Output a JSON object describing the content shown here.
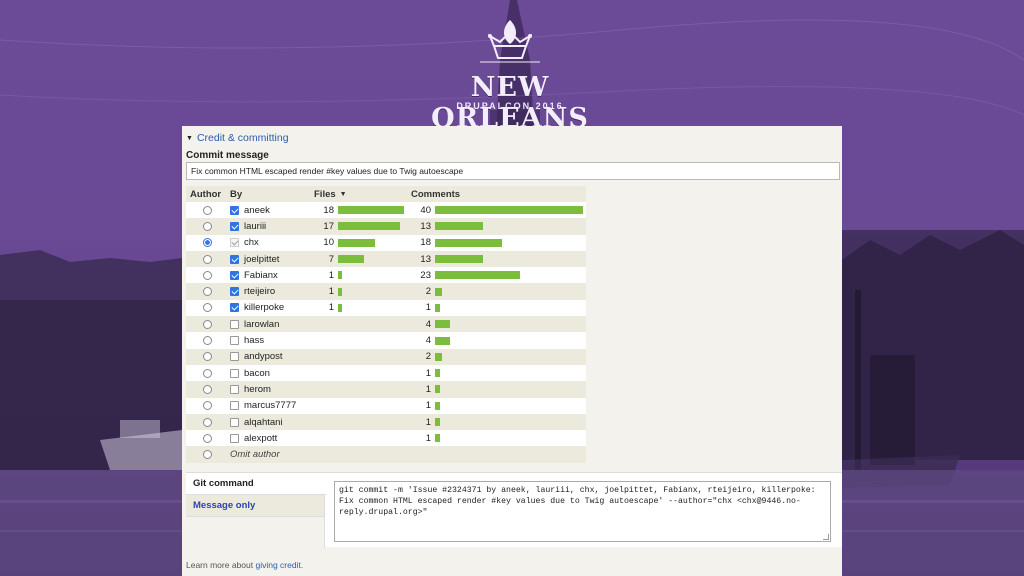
{
  "logo": {
    "title": "NEW ORLEANS",
    "subtitle": "DRUPALCON 2016",
    "icon": "crown-fleur-de-lis-icon"
  },
  "details": {
    "label": "Credit & committing",
    "icon": "triangle-down-icon"
  },
  "commit_message": {
    "label": "Commit message",
    "value": "Fix common HTML escaped render #key values due to Twig autoescape"
  },
  "table": {
    "headers": {
      "author": "Author",
      "by": "By",
      "files": "Files",
      "comments": "Comments"
    },
    "sort_icon": "sort-desc-icon",
    "rows": [
      {
        "name": "aneek",
        "files": "18",
        "comments": "40",
        "files_pct": 1.0,
        "comments_pct": 1.0,
        "author": false,
        "by": "checked"
      },
      {
        "name": "lauriii",
        "files": "17",
        "comments": "13",
        "files_pct": 0.944,
        "comments_pct": 0.325,
        "author": false,
        "by": "checked"
      },
      {
        "name": "chx",
        "files": "10",
        "comments": "18",
        "files_pct": 0.556,
        "comments_pct": 0.45,
        "author": true,
        "by": "disabled"
      },
      {
        "name": "joelpittet",
        "files": "7",
        "comments": "13",
        "files_pct": 0.389,
        "comments_pct": 0.325,
        "author": false,
        "by": "checked"
      },
      {
        "name": "Fabianx",
        "files": "1",
        "comments": "23",
        "files_pct": 0.056,
        "comments_pct": 0.575,
        "author": false,
        "by": "checked"
      },
      {
        "name": "rteijeiro",
        "files": "1",
        "comments": "2",
        "files_pct": 0.056,
        "comments_pct": 0.05,
        "author": false,
        "by": "checked"
      },
      {
        "name": "killerpoke",
        "files": "1",
        "comments": "1",
        "files_pct": 0.056,
        "comments_pct": 0.025,
        "author": false,
        "by": "checked"
      },
      {
        "name": "larowlan",
        "files": "",
        "comments": "4",
        "files_pct": 0,
        "comments_pct": 0.1,
        "author": false,
        "by": "unchecked"
      },
      {
        "name": "hass",
        "files": "",
        "comments": "4",
        "files_pct": 0,
        "comments_pct": 0.1,
        "author": false,
        "by": "unchecked"
      },
      {
        "name": "andypost",
        "files": "",
        "comments": "2",
        "files_pct": 0,
        "comments_pct": 0.05,
        "author": false,
        "by": "unchecked"
      },
      {
        "name": "bacon",
        "files": "",
        "comments": "1",
        "files_pct": 0,
        "comments_pct": 0.025,
        "author": false,
        "by": "unchecked"
      },
      {
        "name": "herom",
        "files": "",
        "comments": "1",
        "files_pct": 0,
        "comments_pct": 0.025,
        "author": false,
        "by": "unchecked"
      },
      {
        "name": "marcus7777",
        "files": "",
        "comments": "1",
        "files_pct": 0,
        "comments_pct": 0.025,
        "author": false,
        "by": "unchecked"
      },
      {
        "name": "alqahtani",
        "files": "",
        "comments": "1",
        "files_pct": 0,
        "comments_pct": 0.025,
        "author": false,
        "by": "unchecked"
      },
      {
        "name": "alexpott",
        "files": "",
        "comments": "1",
        "files_pct": 0,
        "comments_pct": 0.025,
        "author": false,
        "by": "unchecked"
      }
    ],
    "omit_label": "Omit author"
  },
  "git": {
    "tabs": [
      "Git command",
      "Message only"
    ],
    "command": "git commit -m 'Issue #2324371 by aneek, lauriii, chx, joelpittet, Fabianx, rteijeiro, killerpoke: Fix common HTML escaped render #key values due to Twig autoescape' --author=\"chx <chx@9446.no-reply.drupal.org>\""
  },
  "footer": {
    "prefix": "Learn more about ",
    "link": "giving credit",
    "suffix": "."
  },
  "colors": {
    "bar": "#7bbd3d",
    "link": "#2a5db0",
    "accent": "#2f74e0",
    "background": "#6b4a97"
  }
}
